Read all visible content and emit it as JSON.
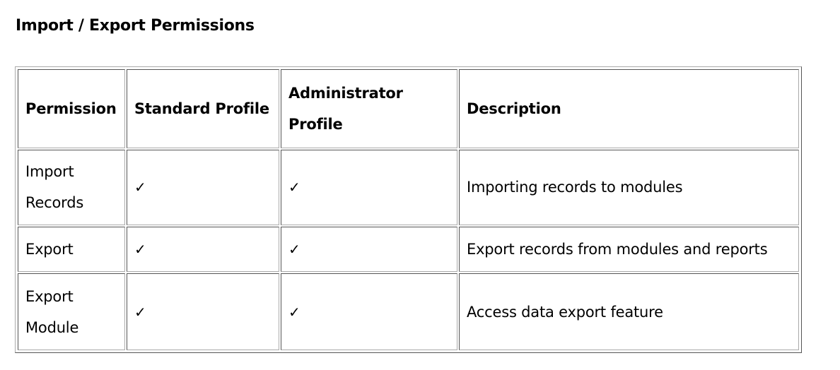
{
  "page": {
    "title": "Import / Export Permissions"
  },
  "table": {
    "headers": [
      "Permission",
      "Standard Profile",
      "Administrator Profile",
      "Description"
    ],
    "rows": [
      {
        "permission": "Import Records",
        "standard_profile": "✓",
        "administrator_profile": "✓",
        "description": "Importing records to modules"
      },
      {
        "permission": "Export",
        "standard_profile": "✓",
        "administrator_profile": "✓",
        "description": "Export records from modules and reports"
      },
      {
        "permission": "Export Module",
        "standard_profile": "✓",
        "administrator_profile": "✓",
        "description": "Access data export feature"
      }
    ]
  },
  "icons": {
    "check": "check-icon"
  }
}
